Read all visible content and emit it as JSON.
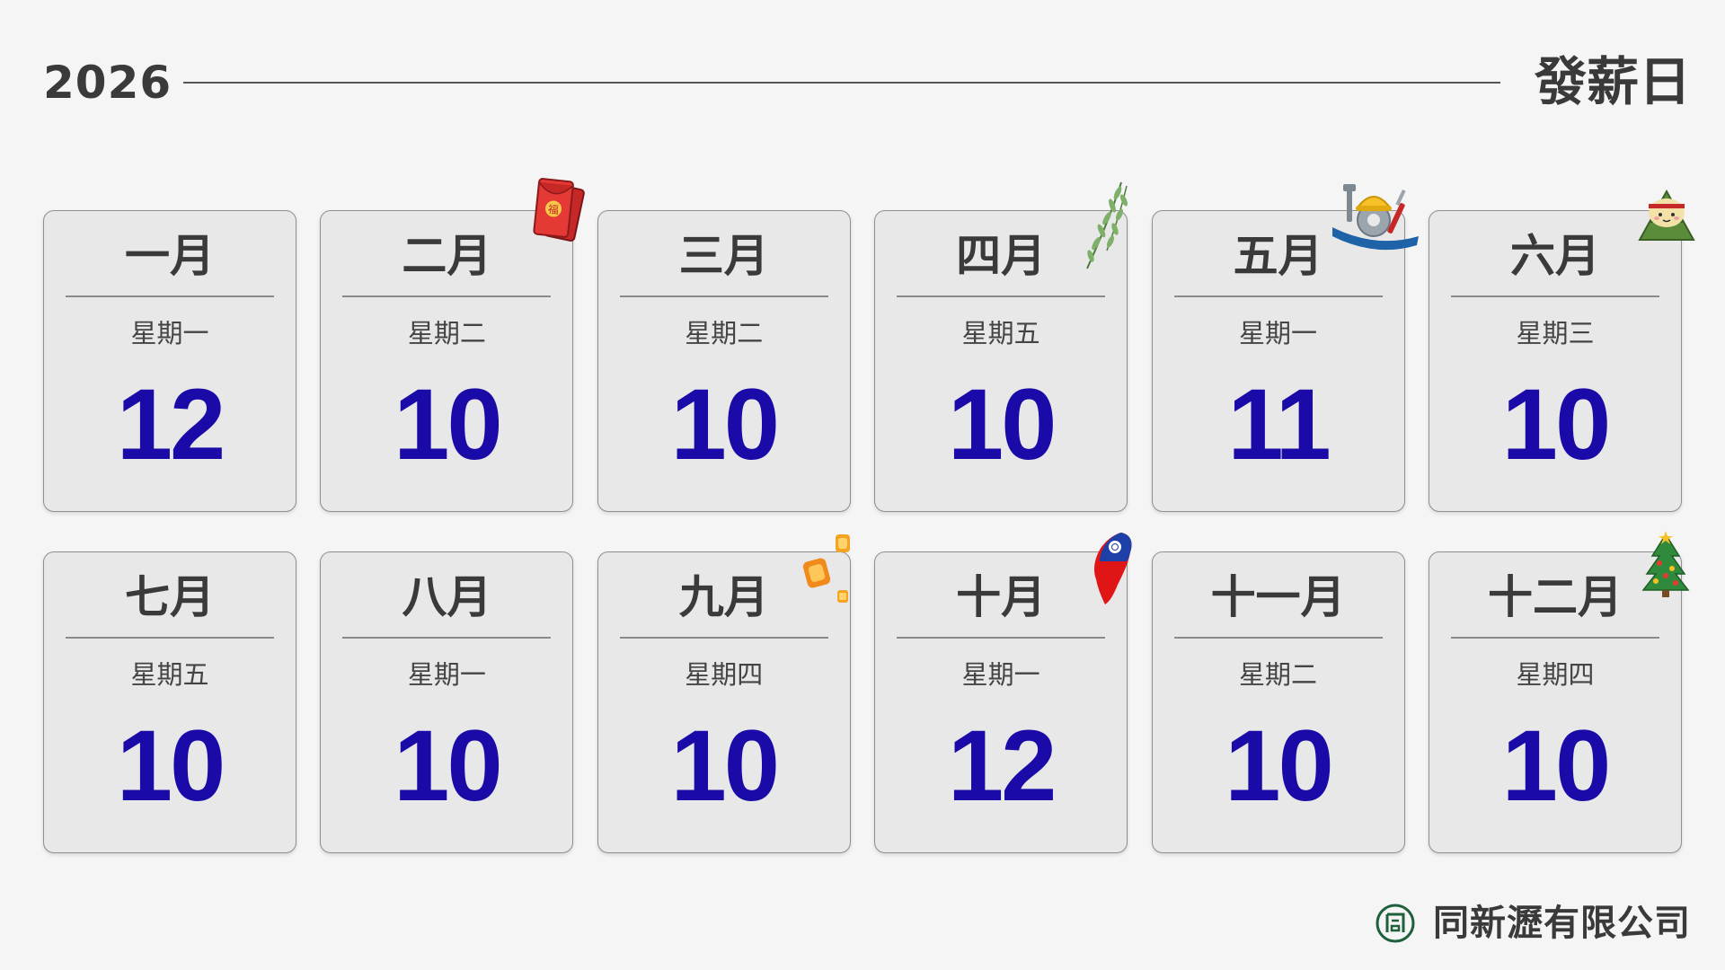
{
  "header": {
    "year": "2026",
    "title": "發薪日"
  },
  "months": [
    {
      "month": "一月",
      "weekday": "星期一",
      "day": "12",
      "decoration": null
    },
    {
      "month": "二月",
      "weekday": "星期二",
      "day": "10",
      "decoration": "red-envelope-icon"
    },
    {
      "month": "三月",
      "weekday": "星期二",
      "day": "10",
      "decoration": null
    },
    {
      "month": "四月",
      "weekday": "星期五",
      "day": "10",
      "decoration": "willow-branch-icon"
    },
    {
      "month": "五月",
      "weekday": "星期一",
      "day": "11",
      "decoration": "labor-day-tools-icon"
    },
    {
      "month": "六月",
      "weekday": "星期三",
      "day": "10",
      "decoration": "rice-dumpling-icon"
    },
    {
      "month": "七月",
      "weekday": "星期五",
      "day": "10",
      "decoration": null
    },
    {
      "month": "八月",
      "weekday": "星期一",
      "day": "10",
      "decoration": null
    },
    {
      "month": "九月",
      "weekday": "星期四",
      "day": "10",
      "decoration": "sky-lanterns-icon"
    },
    {
      "month": "十月",
      "weekday": "星期一",
      "day": "12",
      "decoration": "taiwan-flag-map-icon"
    },
    {
      "month": "十一月",
      "weekday": "星期二",
      "day": "10",
      "decoration": null
    },
    {
      "month": "十二月",
      "weekday": "星期四",
      "day": "10",
      "decoration": "christmas-tree-icon"
    }
  ],
  "footer": {
    "company": "同新瀝有限公司",
    "logo_icon": "company-logo-icon",
    "logo_color": "#1e5f3c"
  },
  "colors": {
    "day_number": "#1a0aa8",
    "card_background": "#e8e8e8",
    "page_background": "#f5f5f5"
  }
}
